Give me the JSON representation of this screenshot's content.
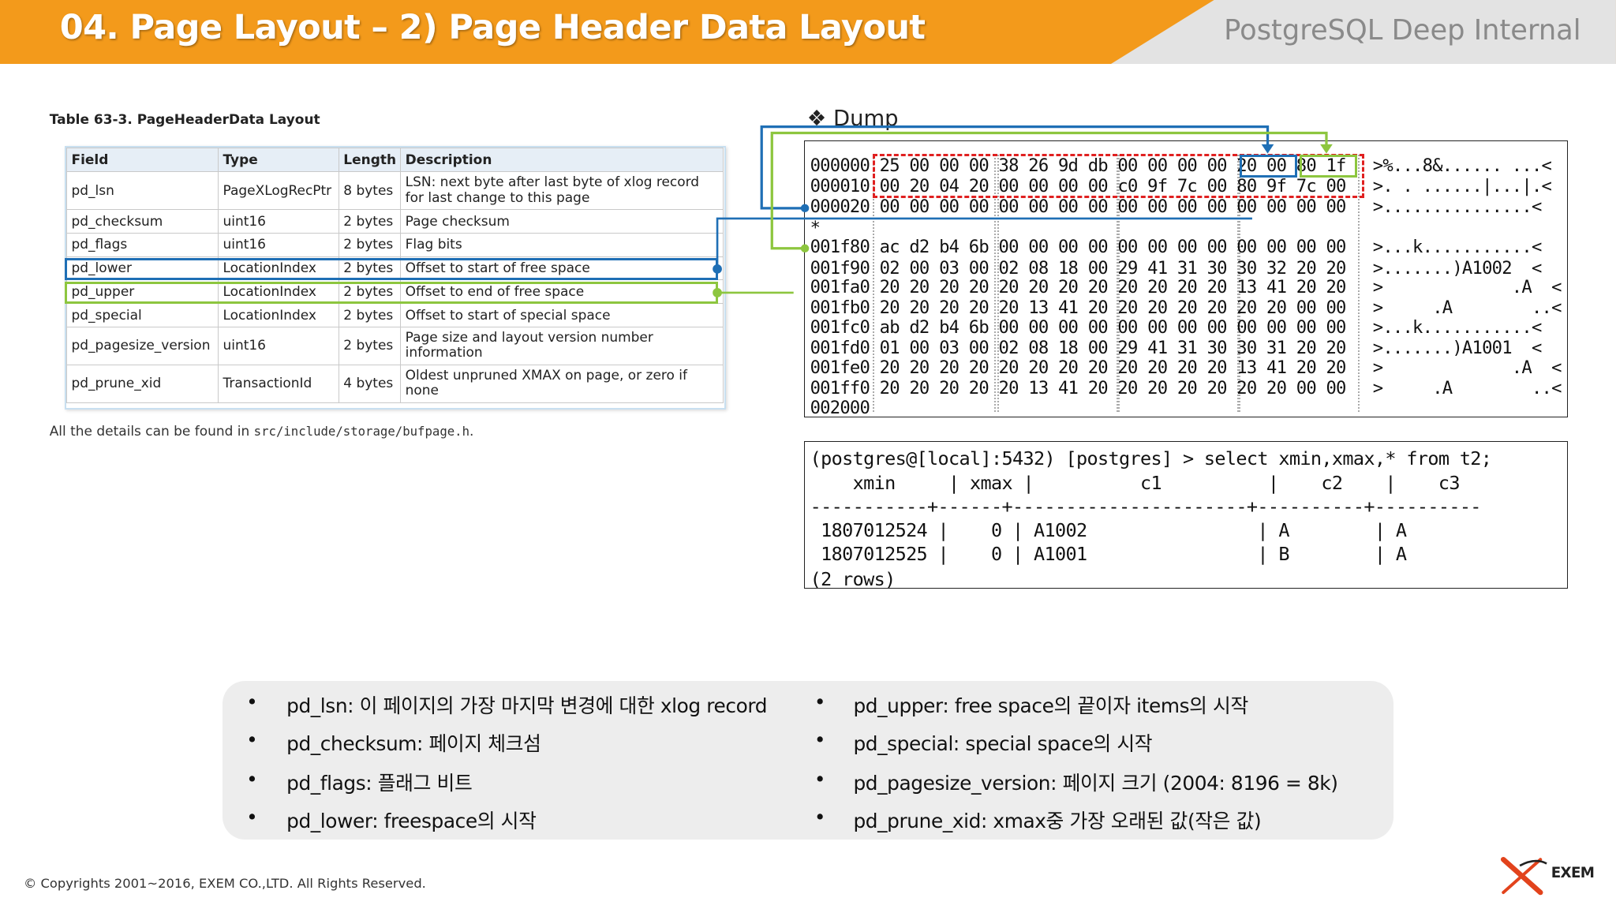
{
  "header": {
    "title": "04. Page Layout – 2) Page Header Data Layout",
    "subtitle": "PostgreSQL Deep Internal"
  },
  "table": {
    "title": "Table 63-3. PageHeaderData Layout",
    "columns": [
      "Field",
      "Type",
      "Length",
      "Description"
    ],
    "rows": [
      [
        "pd_lsn",
        "PageXLogRecPtr",
        "8 bytes",
        "LSN: next byte after last byte of xlog record for last change to this page"
      ],
      [
        "pd_checksum",
        "uint16",
        "2 bytes",
        "Page checksum"
      ],
      [
        "pd_flags",
        "uint16",
        "2 bytes",
        "Flag bits"
      ],
      [
        "pd_lower",
        "LocationIndex",
        "2 bytes",
        "Offset to start of free space"
      ],
      [
        "pd_upper",
        "LocationIndex",
        "2 bytes",
        "Offset to end of free space"
      ],
      [
        "pd_special",
        "LocationIndex",
        "2 bytes",
        "Offset to start of special space"
      ],
      [
        "pd_pagesize_version",
        "uint16",
        "2 bytes",
        "Page size and layout version number information"
      ],
      [
        "pd_prune_xid",
        "TransactionId",
        "4 bytes",
        "Oldest unpruned XMAX on page, or zero if none"
      ]
    ],
    "note_prefix": "All the details can be found in ",
    "note_path": "src/include/storage/bufpage.h",
    "note_suffix": "."
  },
  "dump": {
    "title": "❖  Dump",
    "lines": [
      {
        "hex": "000000 25 00 00 00 38 26 9d db 00 00 00 00 20 00 80 1f",
        "ascii": ">%...8&...... ...<"
      },
      {
        "hex": "000010 00 20 04 20 00 00 00 00 c0 9f 7c 00 80 9f 7c 00",
        "ascii": ">. . ......|...|.<"
      },
      {
        "hex": "000020 00 00 00 00 00 00 00 00 00 00 00 00 00 00 00 00",
        "ascii": ">...............<"
      },
      {
        "hex": "*",
        "ascii": ""
      },
      {
        "hex": "001f80 ac d2 b4 6b 00 00 00 00 00 00 00 00 00 00 00 00",
        "ascii": ">...k...........<"
      },
      {
        "hex": "001f90 02 00 03 00 02 08 18 00 29 41 31 30 30 32 20 20",
        "ascii": ">.......)A1002  <"
      },
      {
        "hex": "001fa0 20 20 20 20 20 20 20 20 20 20 20 20 13 41 20 20",
        "ascii": ">             .A  <"
      },
      {
        "hex": "001fb0 20 20 20 20 20 13 41 20 20 20 20 20 20 20 00 00",
        "ascii": ">     .A        ..<"
      },
      {
        "hex": "001fc0 ab d2 b4 6b 00 00 00 00 00 00 00 00 00 00 00 00",
        "ascii": ">...k...........<"
      },
      {
        "hex": "001fd0 01 00 03 00 02 08 18 00 29 41 31 30 30 31 20 20",
        "ascii": ">.......)A1001  <"
      },
      {
        "hex": "001fe0 20 20 20 20 20 20 20 20 20 20 20 20 13 41 20 20",
        "ascii": ">             .A  <"
      },
      {
        "hex": "001ff0 20 20 20 20 20 13 41 20 20 20 20 20 20 20 00 00",
        "ascii": ">     .A        ..<"
      },
      {
        "hex": "002000",
        "ascii": ""
      }
    ]
  },
  "sql": {
    "lines": [
      "(postgres@[local]:5432) [postgres] > select xmin,xmax,* from t2;",
      "    xmin     | xmax |          c1          |    c2    |    c3",
      "-----------+------+----------------------+----------+----------",
      " 1807012524 |    0 | A1002                | A        | A",
      " 1807012525 |    0 | A1001                | B        | A",
      "(2 rows)"
    ]
  },
  "bullets": {
    "left": [
      "pd_lsn: 이 페이지의 가장 마지막 변경에 대한 xlog record",
      "pd_checksum: 페이지 체크섬",
      "pd_flags: 플래그 비트",
      "pd_lower: freespace의 시작"
    ],
    "right": [
      "pd_upper: free space의 끝이자 items의 시작",
      "pd_special: special space의 시작",
      "pd_pagesize_version: 페이지 크기 (2004: 8196 = 8k)",
      "pd_prune_xid: xmax중 가장 오래된 값(작은 값)"
    ],
    "marker": "•"
  },
  "footer": {
    "copyright": "© Copyrights 2001~2016, EXEM CO.,LTD. All Rights Reserved.",
    "logo_text": "EXEM"
  },
  "colors": {
    "header_orange": "#f39a1b",
    "highlight_blue": "#1f6fb5",
    "highlight_green": "#8dc63f",
    "highlight_red": "#e02020"
  }
}
